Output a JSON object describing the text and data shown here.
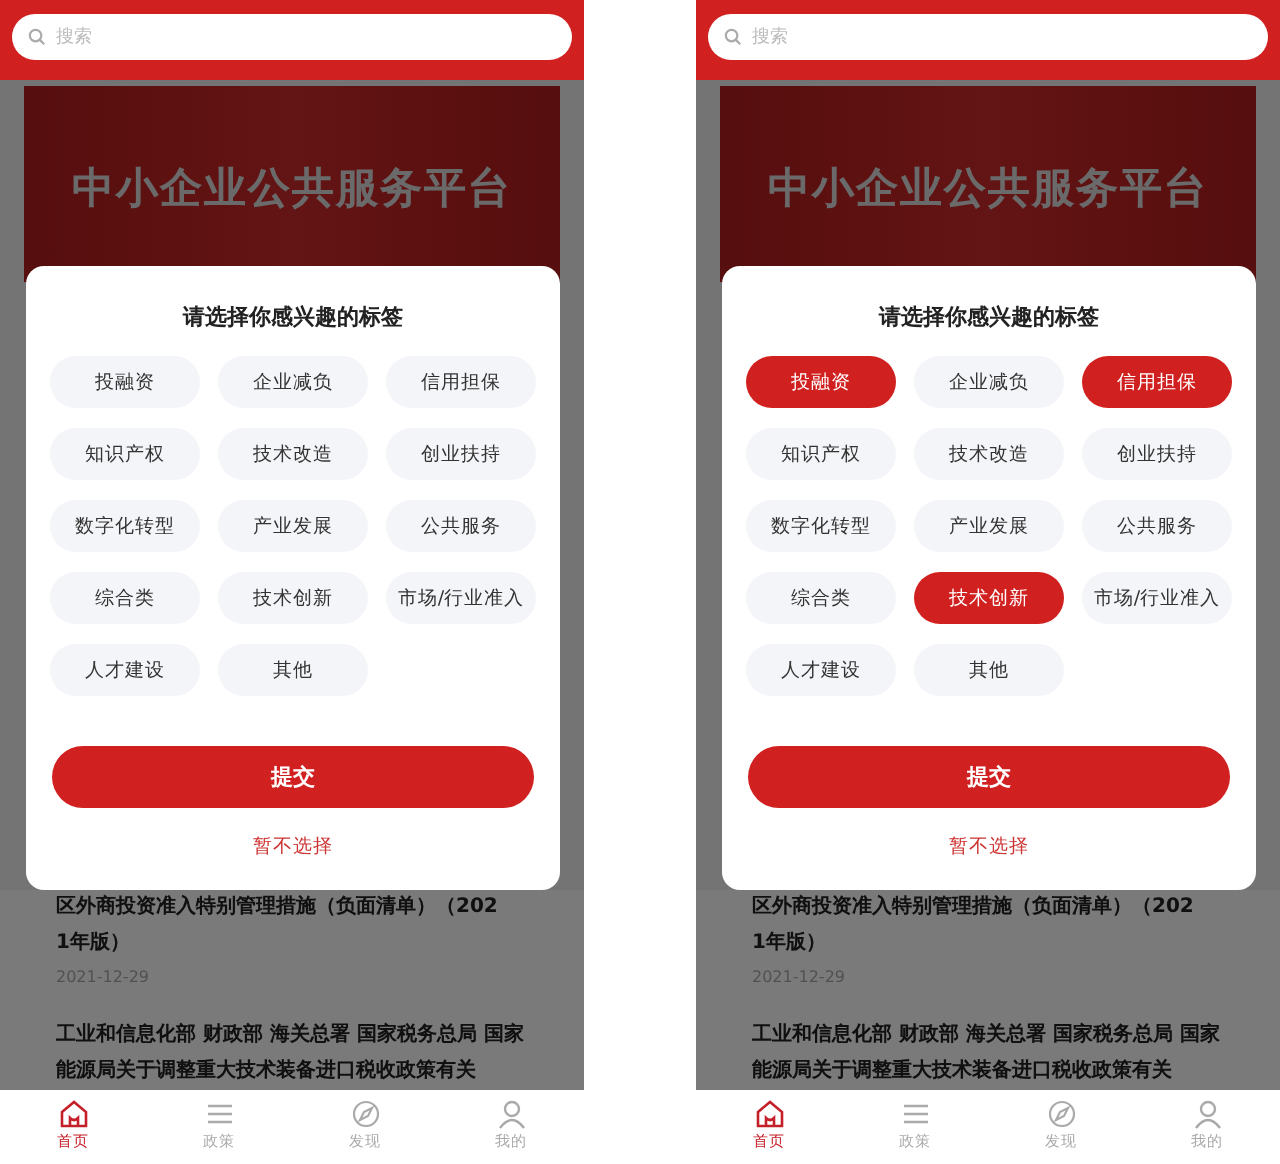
{
  "screens": [
    {
      "search": {
        "placeholder": "搜索"
      },
      "banner": {
        "title": "中小企业公共服务平台"
      },
      "modal": {
        "title": "请选择你感兴趣的标签",
        "tags": [
          {
            "label": "投融资",
            "selected": false
          },
          {
            "label": "企业减负",
            "selected": false
          },
          {
            "label": "信用担保",
            "selected": false
          },
          {
            "label": "知识产权",
            "selected": false
          },
          {
            "label": "技术改造",
            "selected": false
          },
          {
            "label": "创业扶持",
            "selected": false
          },
          {
            "label": "数字化转型",
            "selected": false
          },
          {
            "label": "产业发展",
            "selected": false
          },
          {
            "label": "公共服务",
            "selected": false
          },
          {
            "label": "综合类",
            "selected": false
          },
          {
            "label": "技术创新",
            "selected": false
          },
          {
            "label": "市场/行业准入",
            "selected": false
          },
          {
            "label": "人才建设",
            "selected": false
          },
          {
            "label": "其他",
            "selected": false
          }
        ],
        "submit": "提交",
        "skip": "暂不选择"
      },
      "news": [
        {
          "title": "区外商投资准入特别管理措施（负面清单）（2021年版）",
          "date": "2021-12-29"
        },
        {
          "title": "工业和信息化部 财政部 海关总署 国家税务总局 国家能源局关于调整重大技术装备进口税收政策有关"
        }
      ],
      "tabs": [
        {
          "label": "首页",
          "selected": true
        },
        {
          "label": "政策",
          "selected": false
        },
        {
          "label": "发现",
          "selected": false
        },
        {
          "label": "我的",
          "selected": false
        }
      ]
    },
    {
      "search": {
        "placeholder": "搜索"
      },
      "banner": {
        "title": "中小企业公共服务平台"
      },
      "modal": {
        "title": "请选择你感兴趣的标签",
        "tags": [
          {
            "label": "投融资",
            "selected": true
          },
          {
            "label": "企业减负",
            "selected": false
          },
          {
            "label": "信用担保",
            "selected": true
          },
          {
            "label": "知识产权",
            "selected": false
          },
          {
            "label": "技术改造",
            "selected": false
          },
          {
            "label": "创业扶持",
            "selected": false
          },
          {
            "label": "数字化转型",
            "selected": false
          },
          {
            "label": "产业发展",
            "selected": false
          },
          {
            "label": "公共服务",
            "selected": false
          },
          {
            "label": "综合类",
            "selected": false
          },
          {
            "label": "技术创新",
            "selected": true
          },
          {
            "label": "市场/行业准入",
            "selected": false
          },
          {
            "label": "人才建设",
            "selected": false
          },
          {
            "label": "其他",
            "selected": false
          }
        ],
        "submit": "提交",
        "skip": "暂不选择"
      },
      "news": [
        {
          "title": "区外商投资准入特别管理措施（负面清单）（2021年版）",
          "date": "2021-12-29"
        },
        {
          "title": "工业和信息化部 财政部 海关总署 国家税务总局 国家能源局关于调整重大技术装备进口税收政策有关"
        }
      ],
      "tabs": [
        {
          "label": "首页",
          "selected": true
        },
        {
          "label": "政策",
          "selected": false
        },
        {
          "label": "发现",
          "selected": false
        },
        {
          "label": "我的",
          "selected": false
        }
      ]
    }
  ]
}
